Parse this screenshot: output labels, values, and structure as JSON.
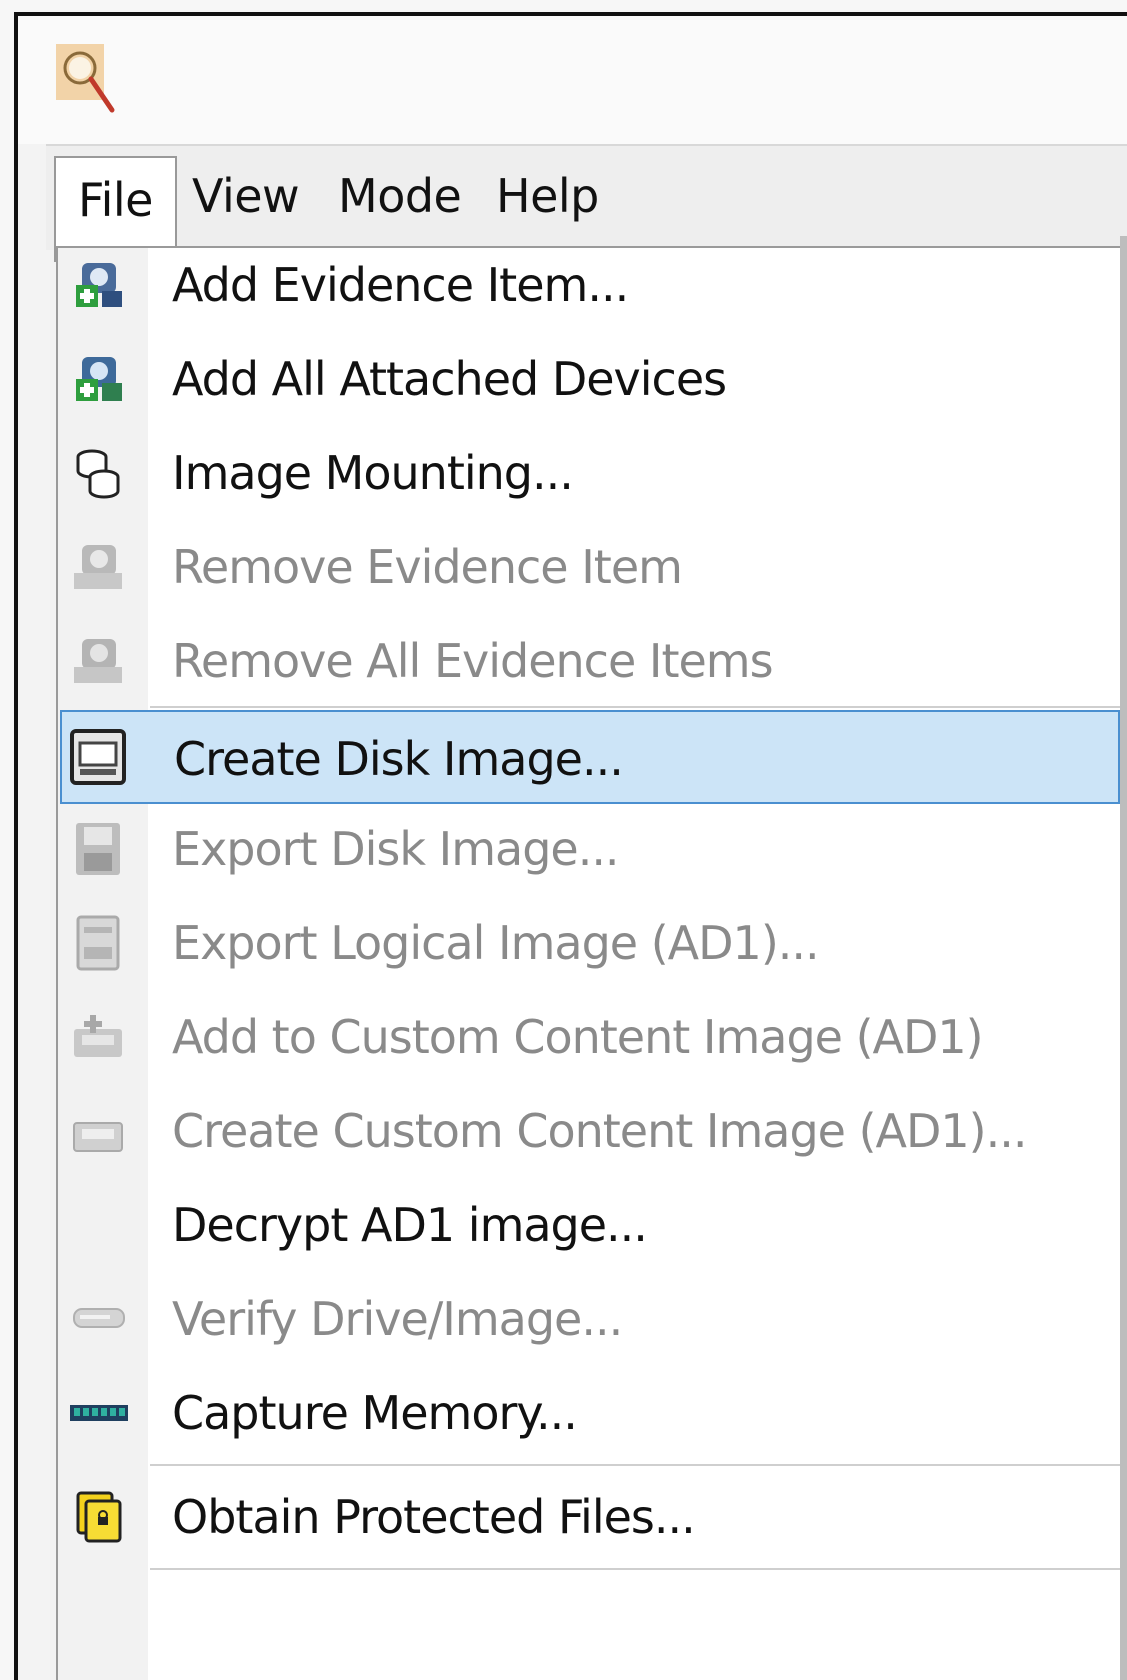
{
  "window": {
    "app_icon": "magnifier-icon"
  },
  "menubar": {
    "items": [
      {
        "label": "File",
        "open": true
      },
      {
        "label": "View"
      },
      {
        "label": "Mode"
      },
      {
        "label": "Help"
      }
    ]
  },
  "file_menu": {
    "items": [
      {
        "label": "Add Evidence Item...",
        "icon": "add-evidence-icon",
        "enabled": true
      },
      {
        "label": "Add All Attached Devices",
        "icon": "add-devices-icon",
        "enabled": true
      },
      {
        "label": "Image Mounting...",
        "icon": "database-icon",
        "enabled": true
      },
      {
        "label": "Remove Evidence Item",
        "icon": "remove-evidence-icon",
        "enabled": false
      },
      {
        "label": "Remove All Evidence Items",
        "icon": "remove-all-evidence-icon",
        "enabled": false
      },
      {
        "label": "Create Disk Image...",
        "icon": "disk-drive-icon",
        "enabled": true,
        "highlighted": true
      },
      {
        "label": "Export Disk Image...",
        "icon": "floppy-icon",
        "enabled": false
      },
      {
        "label": "Export Logical Image (AD1)...",
        "icon": "logical-image-icon",
        "enabled": false
      },
      {
        "label": "Add to Custom Content Image (AD1)",
        "icon": "add-custom-content-icon",
        "enabled": false
      },
      {
        "label": "Create Custom Content Image (AD1)...",
        "icon": "custom-content-icon",
        "enabled": false
      },
      {
        "label": "Decrypt AD1 image...",
        "icon": "",
        "enabled": true
      },
      {
        "label": "Verify Drive/Image...",
        "icon": "verify-drive-icon",
        "enabled": false
      },
      {
        "label": "Capture Memory...",
        "icon": "memory-chip-icon",
        "enabled": true
      },
      {
        "label": "Obtain Protected Files...",
        "icon": "protected-files-icon",
        "enabled": true
      }
    ]
  },
  "colors": {
    "highlight_bg": "#cce4f7",
    "highlight_border": "#4a8fd0",
    "disabled_text": "#8a8a8a"
  }
}
